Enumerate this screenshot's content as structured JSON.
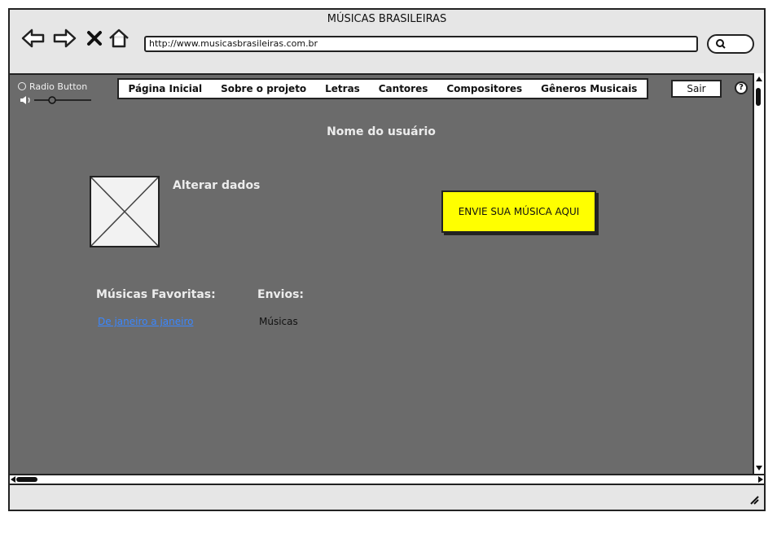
{
  "window": {
    "title": "MÚSICAS BRASILEIRAS"
  },
  "browser": {
    "url": "http://www.musicasbrasileiras.com.br"
  },
  "sidebar": {
    "radio_label": "Radio Button"
  },
  "menu": {
    "items": [
      "Página Inicial",
      "Sobre o projeto",
      "Letras",
      "Cantores",
      "Compositores",
      "Gêneros Musicais"
    ],
    "sair_label": "Sair",
    "help_label": "?"
  },
  "profile": {
    "username": "Nome do usuário",
    "edit_label": "Alterar dados",
    "send_button": "ENVIE SUA MÚSICA AQUI"
  },
  "favorites": {
    "title": "Músicas Favoritas:",
    "items": [
      "De janeiro a janeiro"
    ]
  },
  "uploads": {
    "title": "Envios:",
    "items": [
      "Músicas"
    ]
  },
  "colors": {
    "content_bg": "#6b6b6b",
    "accent_button": "#ffff00",
    "link": "#3a87ff"
  }
}
